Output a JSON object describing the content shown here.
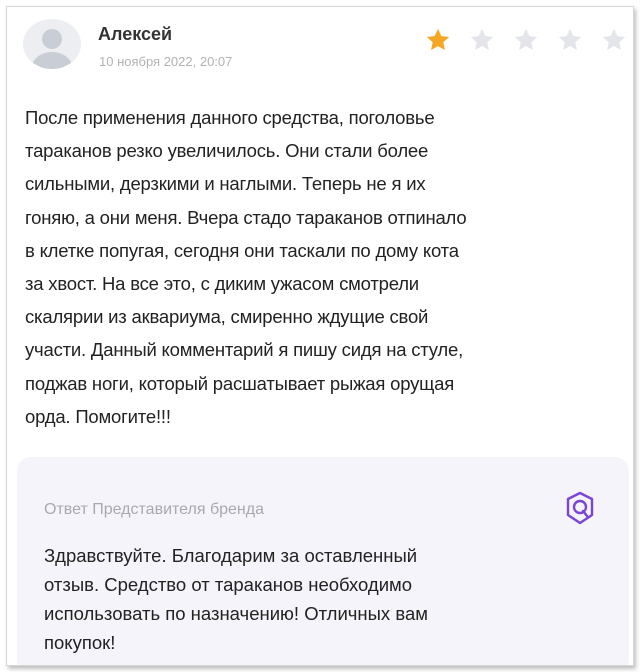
{
  "review": {
    "author": "Алексей",
    "date": "10 ноября 2022, 20:07",
    "rating": 1,
    "max_rating": 5,
    "text_lines": [
      "После применения данного средства, поголовье",
      "тараканов резко увеличилось. Они стали более",
      "сильными, дерзкими и наглыми. Теперь не я их",
      "гоняю, а они меня. Вчера стадо тараканов отпинало",
      "в клетке попугая, сегодня они таскали по дому кота",
      "за хвост. На все это, с диким ужасом смотрели",
      "скалярии из аквариума, смиренно ждущие свой",
      "участи. Данный комментарий я пишу сидя на стуле,",
      "поджав ноги, который расшатывает рыжая орущая",
      "орда. Помогите!!!"
    ]
  },
  "reply": {
    "title": "Ответ Представителя бренда",
    "text_lines": [
      "Здравствуйте. Благодарим за оставленный",
      "отзыв. Средство от тараканов необходимо",
      "использовать по назначению! Отличных вам",
      "покупок!"
    ]
  },
  "colors": {
    "star_filled": "#f5a623",
    "star_empty": "#e3e5ea",
    "reply_bg": "#f5f4fa",
    "brand_icon": "#7b44d8"
  },
  "icons": {
    "avatar": "user-avatar-icon",
    "rating": "star-icon",
    "brand": "brand-badge-icon"
  }
}
